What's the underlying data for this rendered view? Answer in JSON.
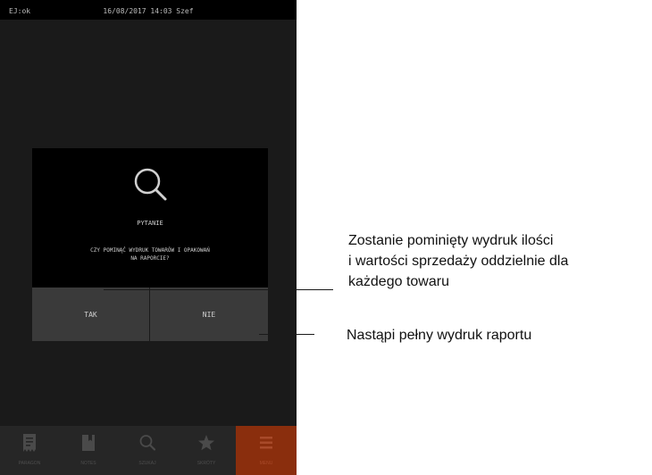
{
  "status_bar": {
    "left": "EJ:ok",
    "center": "16/08/2017 14:03 Szef"
  },
  "dialog": {
    "icon": "search-icon",
    "title": "PYTANIE",
    "question_line1": "CZY POMINĄĆ WYDRUK TOWARÓW I OPAKOWAŃ",
    "question_line2": "NA RAPORCIE?",
    "yes_label": "TAK",
    "no_label": "NIE"
  },
  "nav": {
    "items": [
      {
        "label": "PARAGON",
        "icon": "receipt-icon"
      },
      {
        "label": "NOTES",
        "icon": "notes-icon"
      },
      {
        "label": "SZUKAJ",
        "icon": "search-icon"
      },
      {
        "label": "SKRÓTY",
        "icon": "star-icon"
      },
      {
        "label": "MENU",
        "icon": "menu-icon",
        "active": true
      }
    ]
  },
  "annotations": {
    "yes_line1": "Zostanie pominięty wydruk ilości",
    "yes_line2": "i wartości sprzedaży oddzielnie dla",
    "yes_line3": "każdego towaru",
    "no_text": "Nastąpi pełny wydruk raportu"
  },
  "colors": {
    "screen_bg": "#1a1a1a",
    "dialog_bg": "#000000",
    "button_bg": "#3a3a3a",
    "accent": "#8a2e0d"
  }
}
